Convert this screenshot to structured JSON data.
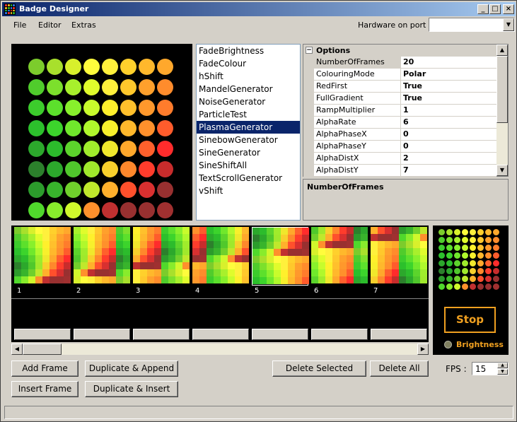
{
  "window": {
    "title": "Badge Designer",
    "minimize": "_",
    "maximize": "□",
    "close": "×"
  },
  "menu": {
    "items": [
      "File",
      "Editor",
      "Extras"
    ],
    "hardware_label": "Hardware on port :",
    "hardware_value": ""
  },
  "generators": {
    "items": [
      "FadeBrightness",
      "FadeColour",
      "hShift",
      "MandelGenerator",
      "NoiseGenerator",
      "ParticleTest",
      "PlasmaGenerator",
      "SinebowGenerator",
      "SineGenerator",
      "SineShiftAll",
      "TextScrollGenerator",
      "vShift"
    ],
    "selected": "PlasmaGenerator"
  },
  "properties": {
    "section": "Options",
    "rows": [
      {
        "name": "NumberOfFrames",
        "value": "20"
      },
      {
        "name": "ColouringMode",
        "value": "Polar"
      },
      {
        "name": "RedFirst",
        "value": "True"
      },
      {
        "name": "FullGradient",
        "value": "True"
      },
      {
        "name": "RampMultiplier",
        "value": "1"
      },
      {
        "name": "AlphaRate",
        "value": "6"
      },
      {
        "name": "AlphaPhaseX",
        "value": "0"
      },
      {
        "name": "AlphaPhaseY",
        "value": "0"
      },
      {
        "name": "AlphaDistX",
        "value": "2"
      },
      {
        "name": "AlphaDistY",
        "value": "7"
      }
    ],
    "selected": "NumberOfFrames",
    "description_title": "NumberOfFrames"
  },
  "preview_colors": [
    [
      "#7ccc2c",
      "#a8e02c",
      "#d8f02c",
      "#fffc3c",
      "#fff03c",
      "#ffd02c",
      "#ffb82c",
      "#ffa82c"
    ],
    [
      "#50cc2c",
      "#7ce02c",
      "#a8f02c",
      "#e0fc2c",
      "#fff03c",
      "#ffc82c",
      "#ffa02c",
      "#ff8c2c"
    ],
    [
      "#3ccc2c",
      "#5ce02c",
      "#88f02c",
      "#c8fc2c",
      "#fff02c",
      "#ffc02c",
      "#ff982c",
      "#ff7c2c"
    ],
    [
      "#2cc02c",
      "#3cd42c",
      "#70e82c",
      "#b0f82c",
      "#f8f02c",
      "#ffb82c",
      "#ff902c",
      "#ff5c2c"
    ],
    [
      "#2ca82c",
      "#2cbc2c",
      "#5cd42c",
      "#a0ec2c",
      "#f0e82c",
      "#ffa82c",
      "#ff602c",
      "#ff2c2c"
    ],
    [
      "#2c802c",
      "#2ca82c",
      "#50c82c",
      "#a0e82c",
      "#f8d02c",
      "#ff882c",
      "#ff3c2c",
      "#c82c2c"
    ],
    [
      "#2c9c2c",
      "#38b42c",
      "#70d02c",
      "#c0e82c",
      "#ffb02c",
      "#ff502c",
      "#d83030",
      "#983030"
    ],
    [
      "#50d82c",
      "#88ec2c",
      "#d0f82c",
      "#ff902c",
      "#c03030",
      "#983030",
      "#983030",
      "#a03030"
    ]
  ],
  "frames": {
    "numbers": [
      "1",
      "2",
      "3",
      "4",
      "5",
      "6",
      "7"
    ],
    "selected": "5"
  },
  "player": {
    "stop_label": "Stop",
    "brightness_label": "Brightness"
  },
  "buttons": {
    "add_frame": "Add Frame",
    "duplicate_append": "Duplicate & Append",
    "insert_frame": "Insert Frame",
    "duplicate_insert": "Duplicate & Insert",
    "delete_selected": "Delete Selected",
    "delete_all": "Delete All"
  },
  "fps": {
    "label": "FPS :",
    "value": "15"
  },
  "colors": {
    "selection": "#0a246a",
    "accent": "#f0a020"
  }
}
